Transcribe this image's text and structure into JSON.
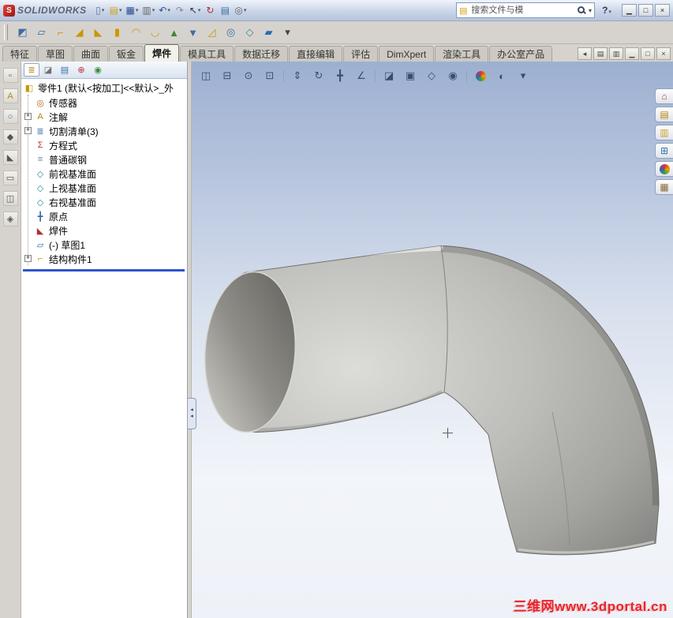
{
  "titlebar": {
    "logo_glyph": "S",
    "logo_text": "SOLIDWORKS",
    "tools": [
      {
        "name": "new-document-icon",
        "glyph": "▯",
        "color": "#5b79a8",
        "dd": true
      },
      {
        "name": "open-icon",
        "glyph": "▤",
        "color": "#d4a017",
        "dd": true
      },
      {
        "name": "save-icon",
        "glyph": "▦",
        "color": "#2a4d8f",
        "dd": true
      },
      {
        "name": "print-icon",
        "glyph": "▥",
        "color": "#666666",
        "dd": true
      },
      {
        "name": "undo-icon",
        "glyph": "↶",
        "color": "#2a4d8f",
        "dd": true
      },
      {
        "name": "redo-icon",
        "glyph": "↷",
        "color": "#8a8a8a"
      },
      {
        "name": "select-icon",
        "glyph": "↖",
        "color": "#333333",
        "dd": true
      },
      {
        "name": "rebuild-icon",
        "glyph": "↻",
        "color": "#b03030"
      },
      {
        "name": "file-properties-icon",
        "glyph": "▤",
        "color": "#3a6ea5"
      },
      {
        "name": "options-icon",
        "glyph": "◎",
        "color": "#666666",
        "dd": true
      }
    ],
    "search": {
      "placeholder": "搜索文件与模",
      "folder_glyph": "▤",
      "dropdown_glyph": "▾"
    },
    "help": {
      "label": "?"
    },
    "window_buttons": [
      {
        "name": "minimize-button",
        "glyph": "▁"
      },
      {
        "name": "restore-button",
        "glyph": "□"
      },
      {
        "name": "close-button",
        "glyph": "×"
      }
    ]
  },
  "weldment_toolbar": [
    {
      "name": "smart-dimension-icon",
      "glyph": "◩",
      "color": "#3a6ea5"
    },
    {
      "name": "3d-sketch-icon",
      "glyph": "▱",
      "color": "#2a6db0"
    },
    {
      "name": "structural-member-icon",
      "glyph": "⌐",
      "color": "#c99700"
    },
    {
      "name": "trim-extend-icon",
      "glyph": "◢",
      "color": "#c99700"
    },
    {
      "name": "gusset-icon",
      "glyph": "◣",
      "color": "#c99700"
    },
    {
      "name": "end-cap-icon",
      "glyph": "▮",
      "color": "#c99700"
    },
    {
      "name": "weld-bead-icon",
      "glyph": "◠",
      "color": "#c99700"
    },
    {
      "name": "fillet-bead-icon",
      "glyph": "◡",
      "color": "#c99700"
    },
    {
      "name": "extruded-boss-icon",
      "glyph": "▲",
      "color": "#3a8a3a"
    },
    {
      "name": "extruded-cut-icon",
      "glyph": "▼",
      "color": "#3a6ea5"
    },
    {
      "name": "chamfer-icon",
      "glyph": "◿",
      "color": "#c99700"
    },
    {
      "name": "hole-wizard-icon",
      "glyph": "◎",
      "color": "#3a6ea5"
    },
    {
      "name": "reference-geometry-icon",
      "glyph": "◇",
      "color": "#2e8b9a"
    },
    {
      "name": "sketch-tools-icon",
      "glyph": "▰",
      "color": "#2a6db0"
    },
    {
      "name": "toolbar-options-icon",
      "glyph": "▾",
      "color": "#444444"
    }
  ],
  "command_tabs": [
    {
      "name": "tab-features",
      "label": "特征"
    },
    {
      "name": "tab-sketch",
      "label": "草图"
    },
    {
      "name": "tab-surfaces",
      "label": "曲面"
    },
    {
      "name": "tab-sheet-metal",
      "label": "钣金"
    },
    {
      "name": "tab-weldments",
      "label": "焊件",
      "active": true
    },
    {
      "name": "tab-mold-tools",
      "label": "模具工具"
    },
    {
      "name": "tab-data-migration",
      "label": "数据迁移"
    },
    {
      "name": "tab-direct-editing",
      "label": "直接编辑"
    },
    {
      "name": "tab-evaluate",
      "label": "评估"
    },
    {
      "name": "tab-dimxpert",
      "label": "DimXpert"
    },
    {
      "name": "tab-render-tools",
      "label": "渲染工具"
    },
    {
      "name": "tab-office-products",
      "label": "办公室产品"
    }
  ],
  "tabrow_icons": [
    {
      "name": "collapse-commandmanager-icon",
      "glyph": "◂"
    },
    {
      "name": "pane-left-icon",
      "glyph": "▤"
    },
    {
      "name": "pane-right-icon",
      "glyph": "▥"
    },
    {
      "name": "doc-minimize-icon",
      "glyph": "▁"
    },
    {
      "name": "doc-restore-icon",
      "glyph": "□"
    },
    {
      "name": "doc-close-icon",
      "glyph": "×"
    }
  ],
  "left_toolbar": [
    {
      "name": "select-tool-icon",
      "glyph": "▫",
      "color": "#555555"
    },
    {
      "name": "note-icon",
      "glyph": "A",
      "color": "#b8860b"
    },
    {
      "name": "balloon-icon",
      "glyph": "○",
      "color": "#3a6ea5"
    },
    {
      "name": "surface-finish-icon",
      "glyph": "◆",
      "color": "#555555"
    },
    {
      "name": "weld-symbol-icon",
      "glyph": "◣",
      "color": "#555555"
    },
    {
      "name": "geometric-tolerance-icon",
      "glyph": "▭",
      "color": "#555555"
    },
    {
      "name": "datum-feature-icon",
      "glyph": "◫",
      "color": "#555555"
    },
    {
      "name": "block-icon",
      "glyph": "◈",
      "color": "#555555"
    }
  ],
  "feature_manager": {
    "tabs": [
      {
        "name": "featuremanager-tree-tab-icon",
        "glyph": "≣",
        "color": "#b8860b",
        "active": true
      },
      {
        "name": "propertymanager-tab-icon",
        "glyph": "◪",
        "color": "#707070"
      },
      {
        "name": "configurationmanager-tab-icon",
        "glyph": "▤",
        "color": "#3a6ea5"
      },
      {
        "name": "dimxpertmanager-tab-icon",
        "glyph": "⊕",
        "color": "#c03030"
      },
      {
        "name": "displaymanager-tab-icon",
        "glyph": "◉",
        "color": "#3a8a3a"
      }
    ],
    "overflow_glyph": "»",
    "root": {
      "label": "零件1 (默认<按加工]<<默认>_外",
      "icon": "part-icon",
      "glyph": "◧",
      "color": "#c99700"
    },
    "items": [
      {
        "label": "传感器",
        "icon": "sensors-icon",
        "glyph": "◎",
        "color": "#b06a00"
      },
      {
        "label": "注解",
        "icon": "annotations-icon",
        "glyph": "A",
        "color": "#b8860b",
        "expand": true
      },
      {
        "label": "切割清单(3)",
        "icon": "cut-list-icon",
        "glyph": "≣",
        "color": "#3a6ea5",
        "expand": true
      },
      {
        "label": "方程式",
        "icon": "equations-icon",
        "glyph": "Σ",
        "color": "#c03030"
      },
      {
        "label": "普通碳钢",
        "icon": "material-icon",
        "glyph": "≡",
        "color": "#708090"
      },
      {
        "label": "前视基准面",
        "icon": "plane-icon",
        "glyph": "◇",
        "color": "#2e8b9a"
      },
      {
        "label": "上视基准面",
        "icon": "plane-icon",
        "glyph": "◇",
        "color": "#2e8b9a"
      },
      {
        "label": "右视基准面",
        "icon": "plane-icon",
        "glyph": "◇",
        "color": "#2e8b9a"
      },
      {
        "label": "原点",
        "icon": "origin-icon",
        "glyph": "╋",
        "color": "#3a6ea5"
      },
      {
        "label": "焊件",
        "icon": "weldment-icon",
        "glyph": "◣",
        "color": "#b03030"
      },
      {
        "label": "(-) 草图1",
        "icon": "sketch-icon",
        "glyph": "▱",
        "color": "#2a6db0"
      },
      {
        "label": "结构构件1",
        "icon": "structural-member-icon",
        "glyph": "⌐",
        "color": "#c99700",
        "expand": true
      }
    ]
  },
  "splitter": {
    "arrow": "◂"
  },
  "headsup_toolbar": [
    {
      "name": "viewport-split-lr-icon",
      "glyph": "◫"
    },
    {
      "name": "viewport-split-tb-icon",
      "glyph": "⊟"
    },
    {
      "name": "zoom-to-fit-icon",
      "glyph": "⊙"
    },
    {
      "name": "zoom-to-area-icon",
      "glyph": "⊡"
    },
    {
      "sep": true
    },
    {
      "name": "zoom-in-out-icon",
      "glyph": "⇕"
    },
    {
      "name": "rotate-view-icon",
      "glyph": "↻"
    },
    {
      "name": "pan-icon",
      "glyph": "╋"
    },
    {
      "name": "measure-icon",
      "glyph": "∠"
    },
    {
      "sep": true
    },
    {
      "name": "section-view-icon",
      "glyph": "◪"
    },
    {
      "name": "view-orientation-icon",
      "glyph": "▣"
    },
    {
      "name": "display-style-icon",
      "glyph": "◇"
    },
    {
      "name": "hide-show-items-icon",
      "glyph": "◉"
    },
    {
      "sep": true
    },
    {
      "name": "edit-appearance-icon",
      "glyph": "●",
      "cls": "ball"
    },
    {
      "name": "apply-scene-icon",
      "glyph": "◐"
    },
    {
      "name": "view-settings-icon",
      "glyph": "▾"
    }
  ],
  "task_pane": [
    {
      "name": "home-icon",
      "glyph": "⌂",
      "color": "#b04a2a"
    },
    {
      "name": "design-library-icon",
      "glyph": "▤",
      "color": "#b8860b"
    },
    {
      "name": "file-explorer-icon",
      "glyph": "▥",
      "color": "#caa02a"
    },
    {
      "name": "view-palette-icon",
      "glyph": "⊞",
      "color": "#3a6ea5"
    },
    {
      "name": "appearances-icon",
      "glyph": "●",
      "cls": "ball"
    },
    {
      "name": "custom-properties-icon",
      "glyph": "▦",
      "color": "#8a6d3b"
    }
  ],
  "graphics": {
    "watermark": "三维网www.3dportal.cn"
  }
}
